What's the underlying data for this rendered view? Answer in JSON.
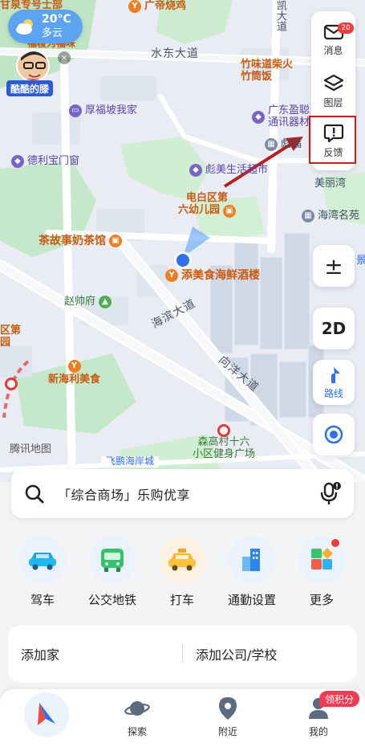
{
  "weather": {
    "temperature": "20°C",
    "condition": "多云"
  },
  "promo": {
    "tag": "酷酷的滕",
    "close": "×"
  },
  "tools": {
    "messages": "消息",
    "messages_badge": "20",
    "layers": "图层",
    "feedback": "反馈"
  },
  "map_controls": {
    "zoom": "±",
    "mode": "2D",
    "route": "路线"
  },
  "map": {
    "roads": {
      "shuidong": "水东大道",
      "haibin": "海滨大道",
      "xiangyang": "向洋大道",
      "kaida": "凯大道"
    },
    "pois": {
      "top_left": "甘泉专号士部",
      "top_left2": "福梭为福味",
      "guangfu": "广帝烧鸡",
      "zhuwei": "竹味道柴火",
      "zhuxiang": "竹筒饭",
      "houfupo": "厚福坡我家",
      "guangdong": "广东盈聪",
      "tongxun": "通讯器材",
      "biaofu": "彪福",
      "deli": "德利宝门窗",
      "biaomei": "彪美生活超市",
      "meiliwan": "美丽湾",
      "dianbai": "电白区第",
      "dianbai2": "六幼儿园",
      "haiwan": "海湾名苑",
      "chagushi": "茶故事奶茶馆",
      "tianmei": "添美食海鲜酒楼",
      "zhaoshuai": "赵帅府",
      "left_edge": "区第",
      "left_edge2": "园",
      "xinhaili": "新海利美食",
      "senggao": "森高村十六",
      "senggao2": "小区健身广场",
      "feipeng": "飞鹏海岸城",
      "jing": "景"
    },
    "watermark": "腾讯地图"
  },
  "search": {
    "placeholder": "「综合商场」乐购优享"
  },
  "quick_actions": [
    {
      "label": "驾车",
      "icon": "car-icon"
    },
    {
      "label": "公交地铁",
      "icon": "bus-icon"
    },
    {
      "label": "打车",
      "icon": "taxi-icon"
    },
    {
      "label": "通勤设置",
      "icon": "commute-icon"
    },
    {
      "label": "更多",
      "icon": "more-icon"
    }
  ],
  "addresses": {
    "home": "添加家",
    "work": "添加公司/学校"
  },
  "tabs": [
    {
      "label": "探索",
      "icon": "planet-icon"
    },
    {
      "label": "附近",
      "icon": "location-pin-icon"
    },
    {
      "label": "我的",
      "icon": "user-icon"
    }
  ],
  "points_badge": "领积分",
  "colors": {
    "accent": "#2f6ff0",
    "highlight": "#c31d1d",
    "badge": "#ee3b3b"
  }
}
